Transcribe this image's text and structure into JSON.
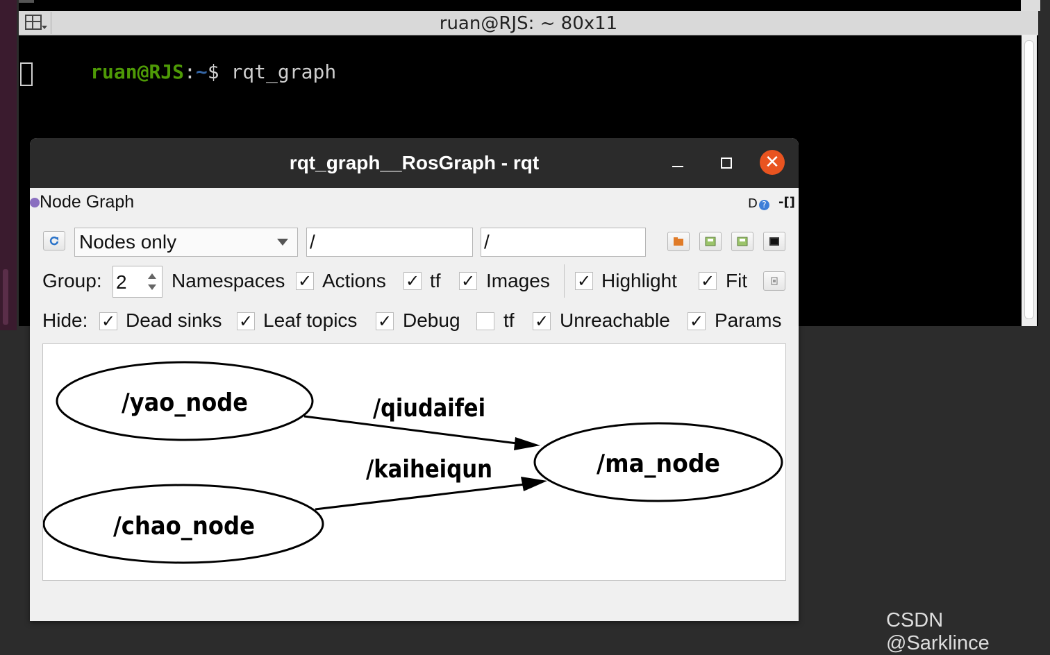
{
  "terminal": {
    "title": "ruan@RJS: ~ 80x11",
    "prompt_user": "ruan@RJS",
    "prompt_sep": ":",
    "prompt_path": "~",
    "prompt_symbol": "$ ",
    "command": "rqt_graph"
  },
  "rqt": {
    "window_title": "rqt_graph__RosGraph - rqt",
    "close_glyph": "✕",
    "dock_title": "Node Graph",
    "dock_help": "D",
    "dock_help_q": "?",
    "dock_close": "-[]",
    "toolbar": {
      "mode_value": "Nodes only",
      "filter1_value": "/",
      "filter2_value": "/"
    },
    "row2": {
      "group_label": "Group:",
      "group_value": "2",
      "namespaces_label": "Namespaces",
      "actions_label": "Actions",
      "tf_label": "tf",
      "images_label": "Images",
      "highlight_label": "Highlight",
      "fit_label": "Fit",
      "check_glyph": "✓",
      "states": {
        "namespaces": true,
        "actions": true,
        "tf": true,
        "images": true,
        "highlight": true,
        "fit": true
      }
    },
    "row3": {
      "hide_label": "Hide:",
      "dead_sinks_label": "Dead sinks",
      "leaf_topics_label": "Leaf topics",
      "debug_label": "Debug",
      "tf_label": "tf",
      "unreachable_label": "Unreachable",
      "params_label": "Params",
      "states": {
        "dead_sinks": true,
        "leaf_topics": true,
        "debug": true,
        "tf": false,
        "unreachable": true,
        "params": true
      }
    },
    "graph": {
      "nodes": [
        "/yao_node",
        "/ma_node",
        "/chao_node"
      ],
      "edges": [
        {
          "from": "/yao_node",
          "to": "/ma_node",
          "label": "/qiudaifei"
        },
        {
          "from": "/chao_node",
          "to": "/ma_node",
          "label": "/kaiheiqun"
        }
      ]
    }
  },
  "watermark": "CSDN @Sarklince"
}
